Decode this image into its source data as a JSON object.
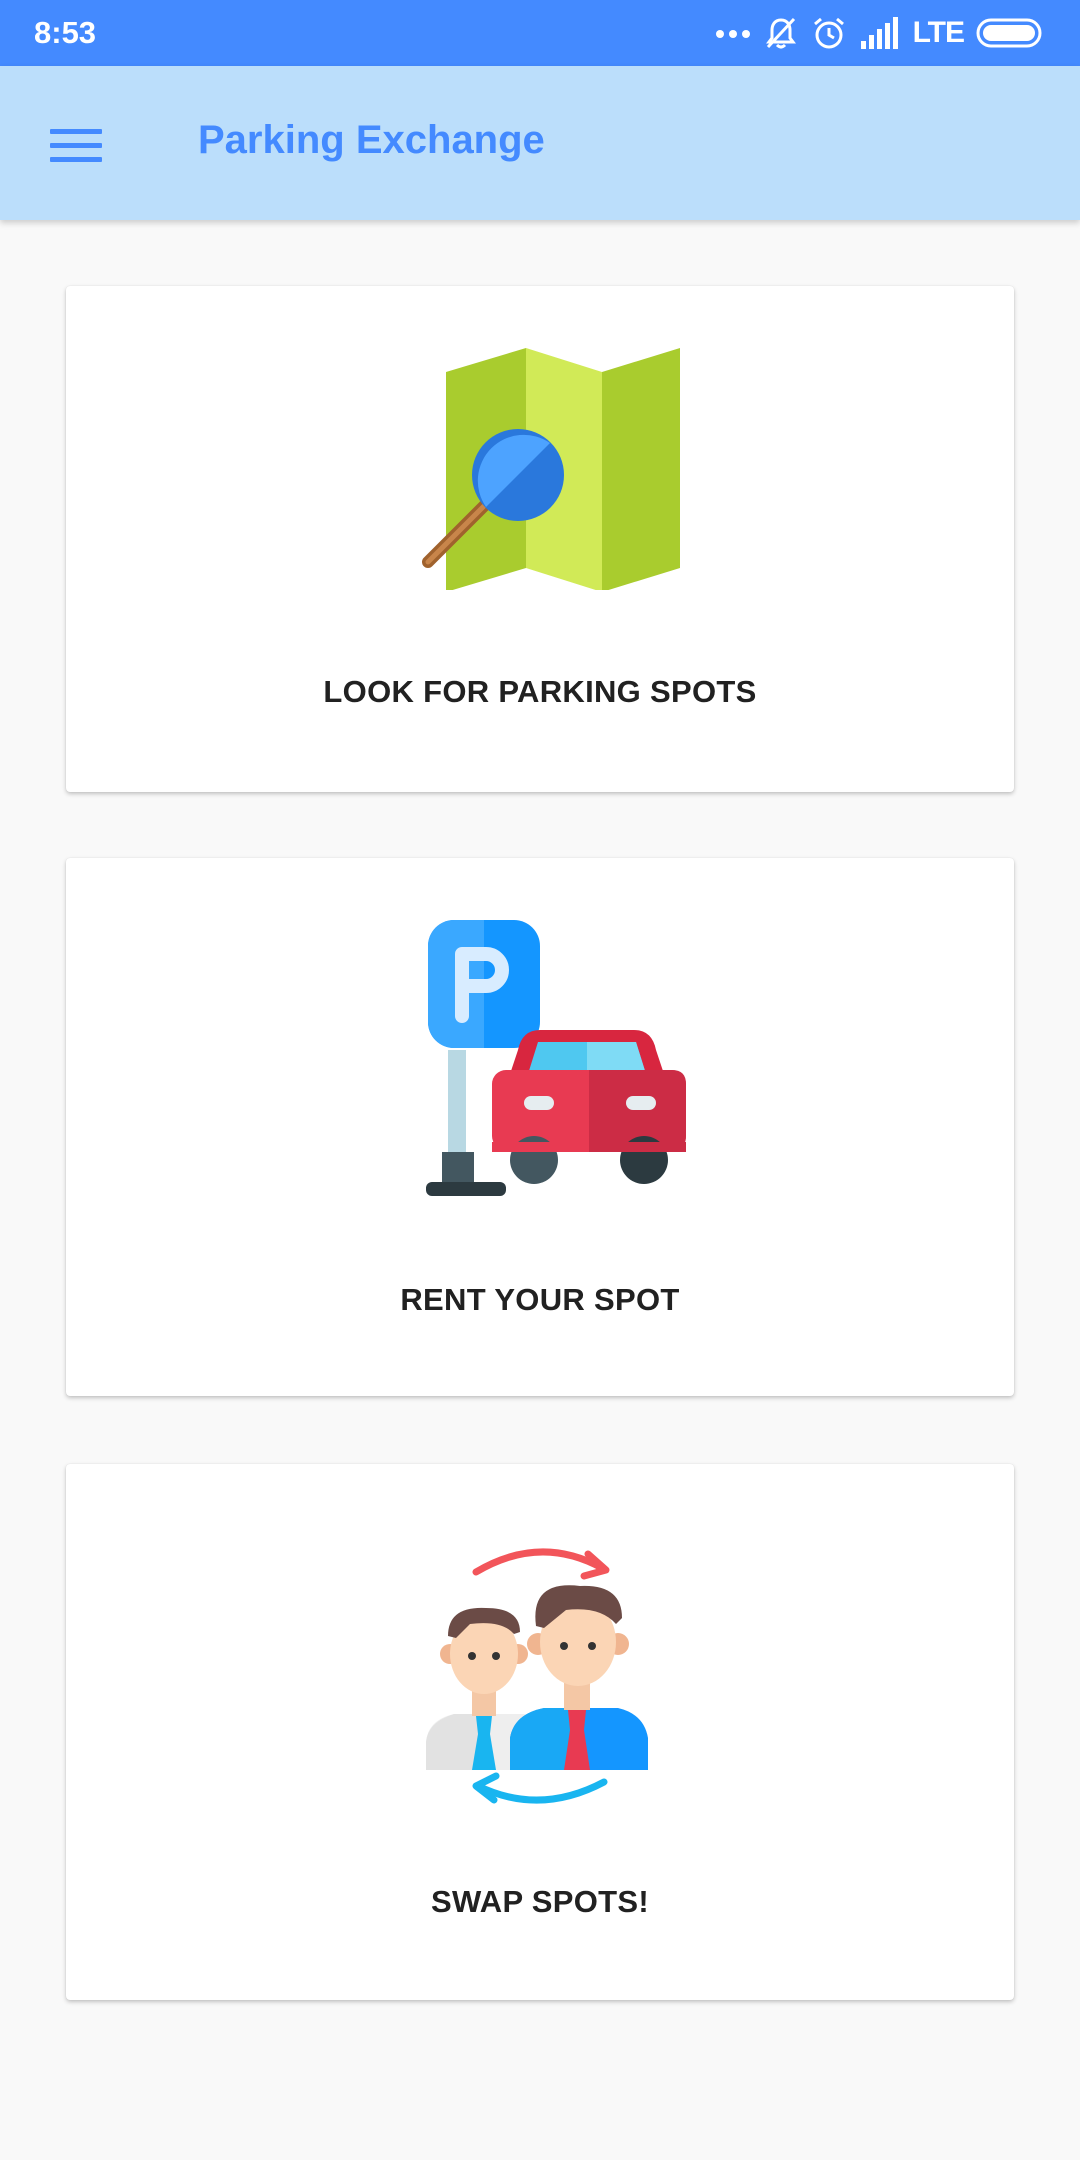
{
  "status_bar": {
    "time": "8:53",
    "network": "LTE",
    "icons": [
      "more-dots-icon",
      "muted-bell-icon",
      "alarm-clock-icon",
      "signal-bars-icon",
      "battery-icon"
    ]
  },
  "app_bar": {
    "title": "Parking Exchange",
    "menu_icon": "hamburger-menu-icon"
  },
  "cards": [
    {
      "label": "LOOK FOR PARKING SPOTS",
      "icon": "map-search-icon"
    },
    {
      "label": "RENT YOUR SPOT",
      "icon": "parking-sign-car-icon"
    },
    {
      "label": "SWAP SPOTS!",
      "icon": "swap-people-icon"
    }
  ],
  "colors": {
    "status_bar": "#448aff",
    "app_bar": "#bbdefb",
    "title": "#448aff",
    "background": "#f9f9f9",
    "card": "#ffffff"
  }
}
